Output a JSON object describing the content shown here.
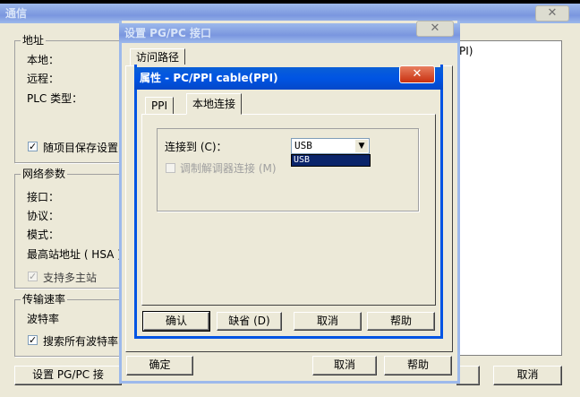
{
  "top_strip": {
    "color": "#000000"
  },
  "main_window": {
    "title": "通信",
    "close_label": "✕",
    "address_group": {
      "label": "地址",
      "local_label": "本地：",
      "remote_label": "远程：",
      "plc_type_label": "PLC 类型：",
      "save_with_project_label": "随项目保存设置"
    },
    "network_group": {
      "label": "网络参数",
      "interface_label": "接口：",
      "protocol_label": "协议：",
      "mode_label": "模式：",
      "hsa_label": "最高站地址 ( HSA )",
      "multimaster_label": "支持多主站"
    },
    "baud_group": {
      "label": "传输速率",
      "baud_label": "波特率",
      "search_all_label": "搜索所有波特率"
    },
    "right_panel_text": "PI)",
    "set_pgpc_button": "设置 PG/PC 接",
    "cancel_button": "取消"
  },
  "pgpc_dialog": {
    "title": "设置 PG/PC 接口",
    "tab_access_path": "访问路径",
    "ok_button": "确定",
    "cancel_button": "取消",
    "help_button": "帮助"
  },
  "properties_dialog": {
    "title": "属性 - PC/PPI cable(PPI)",
    "tabs": [
      "PPI",
      "本地连接"
    ],
    "connect_to_label": "连接到 (C)：",
    "connect_to_value": "USB",
    "connect_to_options": [
      "USB"
    ],
    "modem_label": "调制解调器连接 (M)",
    "ok_button": "确认",
    "default_button": "缺省 (D)",
    "cancel_button": "取消",
    "help_button": "帮助"
  },
  "colors": {
    "active_title": "#0054e3",
    "inactive_title": "#7a96df",
    "face": "#ece9d8",
    "selection": "#0a246a"
  }
}
